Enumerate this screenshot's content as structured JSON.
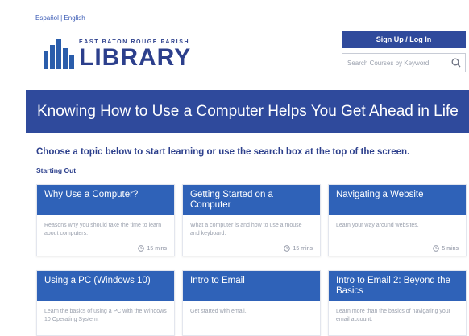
{
  "header": {
    "top_link": "Español | English",
    "logo": {
      "subtitle": "EAST BATON ROUGE PARISH",
      "title": "LIBRARY"
    },
    "signup_label": "Sign Up / Log In",
    "search": {
      "placeholder": "Search Courses by Keyword",
      "icon": "search-icon"
    }
  },
  "hero": {
    "title": "Knowing How to Use a Computer Helps You Get Ahead in Life"
  },
  "main": {
    "subtitle": "Choose a topic below to start learning or use the search box at the top of the screen.",
    "section_label": "Starting Out",
    "courses": [
      {
        "title": "Why Use a Computer?",
        "description": "Reasons why you should take the time to learn about computers.",
        "duration": "15 mins"
      },
      {
        "title": "Getting Started on a Computer",
        "description": "What a computer is and how to use a mouse and keyboard.",
        "duration": "15 mins"
      },
      {
        "title": "Navigating a Website",
        "description": "Learn your way around websites.",
        "duration": "5 mins"
      },
      {
        "title": "Using a PC (Windows 10)",
        "description": "Learn the basics of using a PC with the Windows 10 Operating System.",
        "duration": ""
      },
      {
        "title": "Intro to Email",
        "description": "Get started with email.",
        "duration": ""
      },
      {
        "title": "Intro to Email 2: Beyond the Basics",
        "description": "Learn more than the basics of navigating your email account.",
        "duration": ""
      }
    ]
  },
  "colors": {
    "brand_blue": "#2f4a9c",
    "card_blue": "#2f62b8",
    "text_navy": "#2c3f8c"
  }
}
